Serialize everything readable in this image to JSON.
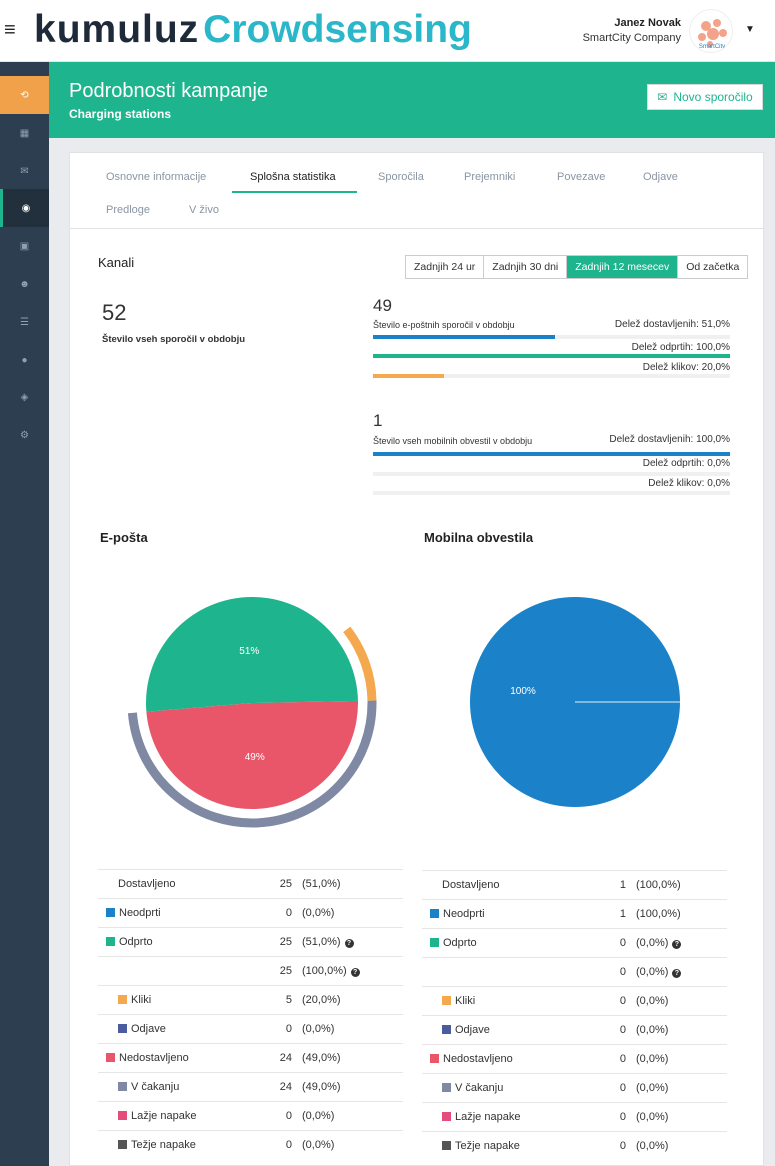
{
  "header": {
    "logo_part1": "kumuluz",
    "logo_part2": "Crowdsensing",
    "user_name": "Janez Novak",
    "user_company": "SmartCity Company",
    "avatar_text": "SmartCity"
  },
  "sidebar": {
    "items": [
      {
        "icon": "refresh-icon"
      },
      {
        "icon": "dashboard-icon"
      },
      {
        "icon": "envelope-icon"
      },
      {
        "icon": "globe-icon"
      },
      {
        "icon": "image-icon"
      },
      {
        "icon": "users-icon"
      },
      {
        "icon": "list-icon"
      },
      {
        "icon": "map-marker-icon"
      },
      {
        "icon": "cube-icon"
      },
      {
        "icon": "gear-icon"
      }
    ]
  },
  "titlebar": {
    "title": "Podrobnosti kampanje",
    "subtitle": "Charging stations",
    "new_message_label": "Novo sporočilo"
  },
  "tabs": [
    {
      "label": "Osnovne informacije"
    },
    {
      "label": "Splošna statistika"
    },
    {
      "label": "Sporočila"
    },
    {
      "label": "Prejemniki"
    },
    {
      "label": "Povezave"
    },
    {
      "label": "Odjave"
    },
    {
      "label": "Predloge"
    },
    {
      "label": "V živo"
    }
  ],
  "channels": {
    "title": "Kanali",
    "periods": [
      "Zadnjih 24 ur",
      "Zadnjih 30 dni",
      "Zadnjih 12 mesecev",
      "Od začetka"
    ],
    "active_period": "Zadnjih 12 mesecev",
    "total_count": "52",
    "total_label": "Število vseh sporočil v obdobju",
    "email": {
      "count": "49",
      "label": "Število e-poštnih sporočil v obdobju",
      "delivered": "Delež dostavljenih: 51,0%",
      "opened": "Delež odprtih: 100,0%",
      "clicks": "Delež klikov: 20,0%",
      "delivered_fraction": 0.51,
      "opened_fraction": 1.0,
      "clicks_fraction": 0.2
    },
    "mobile": {
      "count": "1",
      "label": "Število vseh mobilnih obvestil v obdobju",
      "delivered": "Delež dostavljenih: 100,0%",
      "opened": "Delež odprtih: 0,0%",
      "clicks": "Delež klikov: 0,0%",
      "delivered_fraction": 1.0,
      "opened_fraction": 0.0,
      "clicks_fraction": 0.0
    }
  },
  "colors": {
    "accent": "#1eb58e",
    "blue": "#1b82c9",
    "red": "#e9566a",
    "orange": "#f4a94f",
    "slate": "#7f89a3",
    "navy": "#4c5aa0",
    "pink": "#e44d7b",
    "dark": "#555555"
  },
  "charts": {
    "email_title": "E-pošta",
    "mobile_title": "Mobilna obvestila",
    "email_slices": [
      {
        "label": "51%",
        "value": 51,
        "color": "#1eb58e"
      },
      {
        "label": "49%",
        "value": 49,
        "color": "#e9566a"
      }
    ],
    "email_outer_ring": [
      {
        "value": 20,
        "color": "#f4a94f"
      },
      {
        "value": 49,
        "color": "#7f89a3"
      }
    ],
    "mobile_slices": [
      {
        "label": "100%",
        "value": 100,
        "color": "#1b82c9"
      }
    ]
  },
  "email_table": [
    {
      "label": "Dostavljeno",
      "num": "25",
      "pct": "(51,0%)",
      "color": "",
      "indent": 0,
      "help": false
    },
    {
      "label": "Neodprti",
      "num": "0",
      "pct": "(0,0%)",
      "color": "#1b82c9",
      "indent": 0,
      "help": false
    },
    {
      "label": "Odprto",
      "num": "25",
      "pct": "(51,0%)",
      "color": "#1eb58e",
      "indent": 0,
      "help": true
    },
    {
      "label": "",
      "num": "25",
      "pct": "(100,0%)",
      "color": "",
      "indent": 0,
      "help": true
    },
    {
      "label": "Kliki",
      "num": "5",
      "pct": "(20,0%)",
      "color": "#f4a94f",
      "indent": 1,
      "help": false
    },
    {
      "label": "Odjave",
      "num": "0",
      "pct": "(0,0%)",
      "color": "#4c5aa0",
      "indent": 1,
      "help": false
    },
    {
      "label": "Nedostavljeno",
      "num": "24",
      "pct": "(49,0%)",
      "color": "#e9566a",
      "indent": 0,
      "help": false
    },
    {
      "label": "V čakanju",
      "num": "24",
      "pct": "(49,0%)",
      "color": "#7f89a3",
      "indent": 1,
      "help": false
    },
    {
      "label": "Lažje napake",
      "num": "0",
      "pct": "(0,0%)",
      "color": "#e44d7b",
      "indent": 1,
      "help": false
    },
    {
      "label": "Težje napake",
      "num": "0",
      "pct": "(0,0%)",
      "color": "#555555",
      "indent": 1,
      "help": false
    }
  ],
  "mobile_table": [
    {
      "label": "Dostavljeno",
      "num": "1",
      "pct": "(100,0%)",
      "color": "",
      "indent": 0,
      "help": false
    },
    {
      "label": "Neodprti",
      "num": "1",
      "pct": "(100,0%)",
      "color": "#1b82c9",
      "indent": 0,
      "help": false
    },
    {
      "label": "Odprto",
      "num": "0",
      "pct": "(0,0%)",
      "color": "#1eb58e",
      "indent": 0,
      "help": true
    },
    {
      "label": "",
      "num": "0",
      "pct": "(0,0%)",
      "color": "",
      "indent": 0,
      "help": true
    },
    {
      "label": "Kliki",
      "num": "0",
      "pct": "(0,0%)",
      "color": "#f4a94f",
      "indent": 1,
      "help": false
    },
    {
      "label": "Odjave",
      "num": "0",
      "pct": "(0,0%)",
      "color": "#4c5aa0",
      "indent": 1,
      "help": false
    },
    {
      "label": "Nedostavljeno",
      "num": "0",
      "pct": "(0,0%)",
      "color": "#e9566a",
      "indent": 0,
      "help": false
    },
    {
      "label": "V čakanju",
      "num": "0",
      "pct": "(0,0%)",
      "color": "#7f89a3",
      "indent": 1,
      "help": false
    },
    {
      "label": "Lažje napake",
      "num": "0",
      "pct": "(0,0%)",
      "color": "#e44d7b",
      "indent": 1,
      "help": false
    },
    {
      "label": "Težje napake",
      "num": "0",
      "pct": "(0,0%)",
      "color": "#555555",
      "indent": 1,
      "help": false
    }
  ]
}
